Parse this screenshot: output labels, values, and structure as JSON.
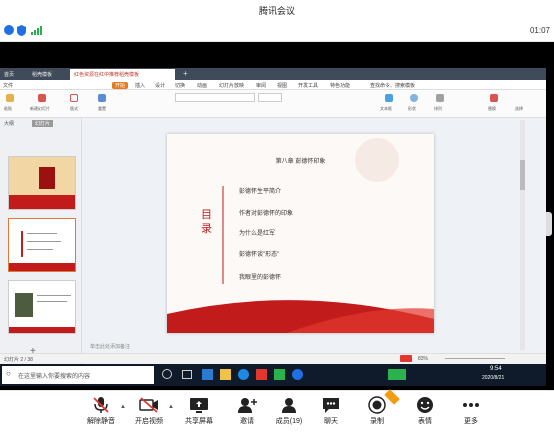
{
  "window": {
    "title": "腾讯会议",
    "timer": "01:07"
  },
  "wps": {
    "tabs": [
      "首页",
      "稻壳模板",
      "红色资源在红中推荐稻壳模板"
    ],
    "menu": [
      "文件",
      "开始",
      "插入",
      "设计",
      "切换",
      "动画",
      "幻灯片放映",
      "审阅",
      "视图",
      "开发工具",
      "特色功能",
      "查找命令、搜索模板"
    ],
    "ribbon": [
      "粘贴",
      "新建幻灯片",
      "版式",
      "重置",
      "节",
      "文本框",
      "形状",
      "排列",
      "替换",
      "选择"
    ],
    "status_left": "幻灯片 2 / 38",
    "status_notes": "单击此处添加备注",
    "zoom": "83%"
  },
  "slide": {
    "heading": "第八章 彭德怀印象",
    "toc_title": "目录",
    "items": [
      "彭德怀生平简介",
      "作者对彭德怀的印象",
      "为什么是红军",
      "彭德怀谈\"形态\"",
      "我眼里的彭德怀"
    ]
  },
  "taskbar": {
    "search_placeholder": "在这里输入你要搜索的内容",
    "time": "9:54",
    "date": "2020/8/21"
  },
  "toolbar": {
    "mute": "解除静音",
    "video": "开启视频",
    "share": "共享屏幕",
    "invite": "邀请",
    "members": "成员(19)",
    "chat": "聊天",
    "record": "录制",
    "emoji": "表情",
    "more": "更多"
  },
  "colors": {
    "accent": "#1f6fe5",
    "slide_red": "#c21b1b",
    "muted_red": "#e2372f"
  }
}
